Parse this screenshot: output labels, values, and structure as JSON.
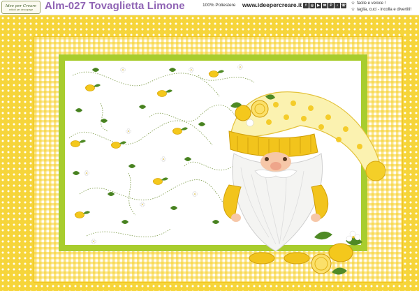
{
  "header": {
    "logo_line1": "Idee per Creare",
    "logo_line2": "articoli per decoupage",
    "title": "Alm-027 Tovaglietta Limone",
    "material": "100% Poliestere",
    "website": "www.ideepercreare.it",
    "social_icons": [
      "facebook-icon",
      "instagram-icon",
      "youtube-icon",
      "email-icon",
      "pinterest-icon",
      "tiktok-icon",
      "whatsapp-icon"
    ],
    "features": [
      "facile e veloce !",
      "taglia, cuci - incolla e divertiti!"
    ]
  },
  "colors": {
    "border_yellow": "#f6d53a",
    "gingham_yellow": "#f7d028",
    "wavy_green": "#a8cd2e",
    "title_purple": "#8f63b4",
    "lemon": "#f4c81c",
    "leaf": "#4f8a25"
  },
  "artwork": {
    "subject": "gnome-with-lemons",
    "pattern": "lemon-branches-on-white"
  }
}
